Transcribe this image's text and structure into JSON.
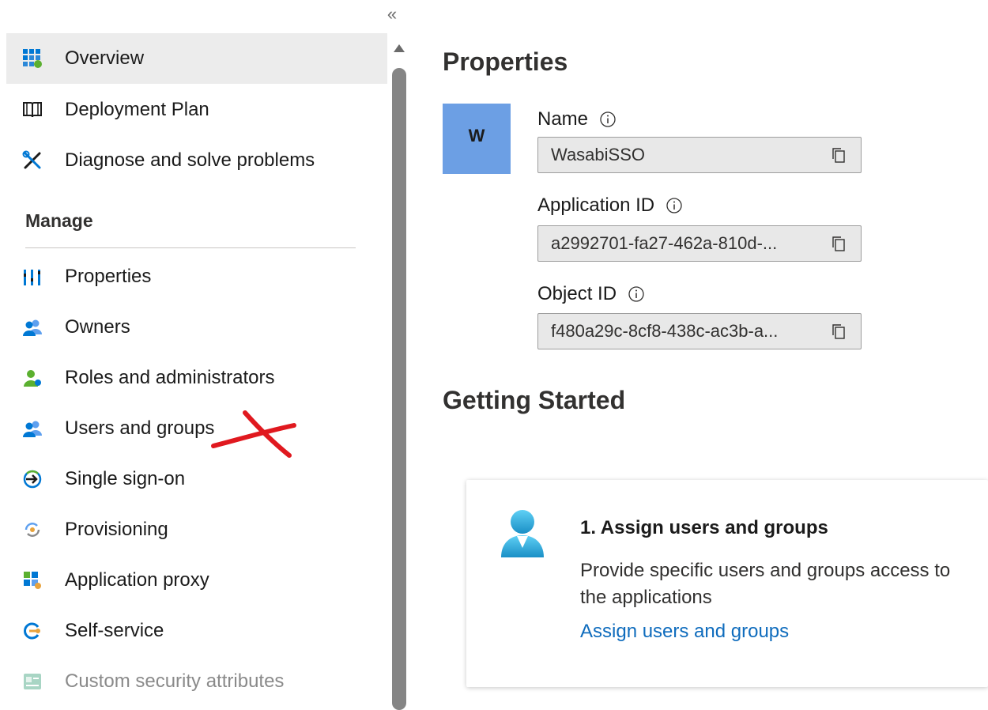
{
  "sidebar": {
    "collapse_glyph": "«",
    "items": [
      {
        "label": "Overview",
        "icon": "overview-grid-icon"
      },
      {
        "label": "Deployment Plan",
        "icon": "book-icon"
      },
      {
        "label": "Diagnose and solve problems",
        "icon": "tools-icon"
      }
    ],
    "manage_header": "Manage",
    "manage_items": [
      {
        "label": "Properties",
        "icon": "properties-bars-icon"
      },
      {
        "label": "Owners",
        "icon": "owners-icon"
      },
      {
        "label": "Roles and administrators",
        "icon": "roles-icon"
      },
      {
        "label": "Users and groups",
        "icon": "users-groups-icon"
      },
      {
        "label": "Single sign-on",
        "icon": "sign-in-arrow-icon"
      },
      {
        "label": "Provisioning",
        "icon": "provisioning-icon"
      },
      {
        "label": "Application proxy",
        "icon": "app-proxy-icon"
      },
      {
        "label": "Self-service",
        "icon": "self-service-icon"
      },
      {
        "label": "Custom security attributes",
        "icon": "custom-attributes-icon"
      }
    ],
    "active_item": "Overview",
    "disabled_item": "Custom security attributes"
  },
  "properties": {
    "title": "Properties",
    "avatar_letter": "W",
    "name_label": "Name",
    "name_value": "WasabiSSO",
    "app_id_label": "Application ID",
    "app_id_value": "a2992701-fa27-462a-810d-...",
    "object_id_label": "Object ID",
    "object_id_value": "f480a29c-8cf8-438c-ac3b-a..."
  },
  "getting_started": {
    "title": "Getting Started",
    "card": {
      "title": "1. Assign users and groups",
      "description": "Provide specific users and groups access to the applications",
      "link": "Assign users and groups",
      "icon": "user-person-icon"
    }
  },
  "colors": {
    "accent_blue": "#0f6cbd",
    "avatar_bg": "#6c9fe4",
    "active_bg": "#ececec",
    "annotation_red": "#e0191f"
  }
}
